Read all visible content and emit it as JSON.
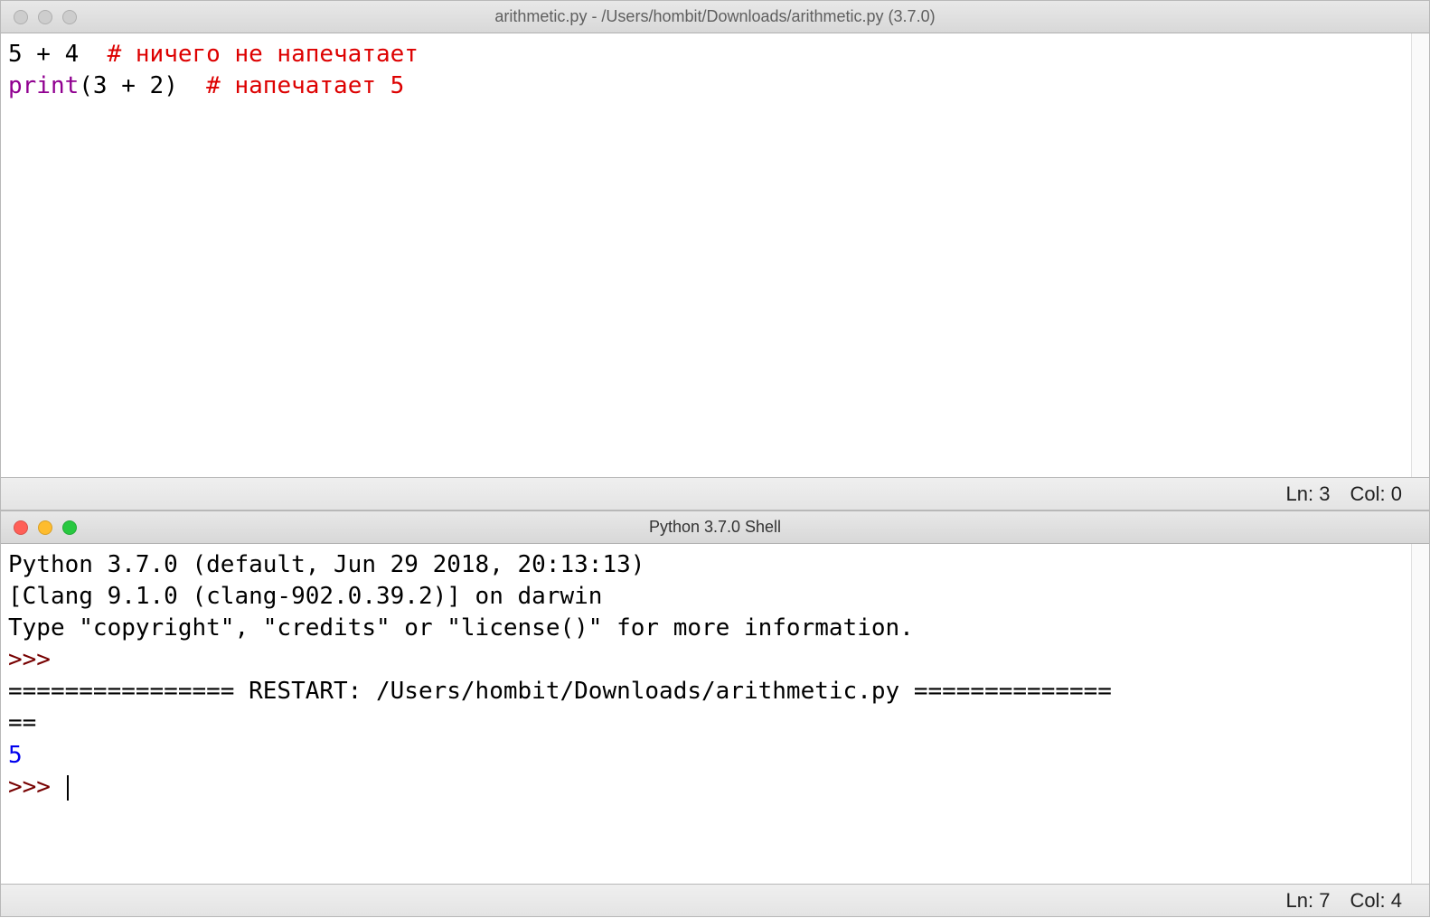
{
  "editor": {
    "title": "arithmetic.py - /Users/hombit/Downloads/arithmetic.py (3.7.0)",
    "line1_code": "5 + 4  ",
    "line1_comment": "# ничего не напечатает",
    "line2_builtin": "print",
    "line2_args": "(3 + 2)  ",
    "line2_comment": "# напечатает 5",
    "status_ln_label": "Ln:",
    "status_ln_value": "3",
    "status_col_label": "Col:",
    "status_col_value": "0"
  },
  "shell": {
    "title": "Python 3.7.0 Shell",
    "banner_line1": "Python 3.7.0 (default, Jun 29 2018, 20:13:13) ",
    "banner_line2": "[Clang 9.1.0 (clang-902.0.39.2)] on darwin",
    "banner_line3": "Type \"copyright\", \"credits\" or \"license()\" for more information.",
    "prompt": ">>> ",
    "restart_line1": "================ RESTART: /Users/hombit/Downloads/arithmetic.py ==============",
    "restart_line2": "==",
    "output_value": "5",
    "status_ln_label": "Ln:",
    "status_ln_value": "7",
    "status_col_label": "Col:",
    "status_col_value": "4"
  }
}
